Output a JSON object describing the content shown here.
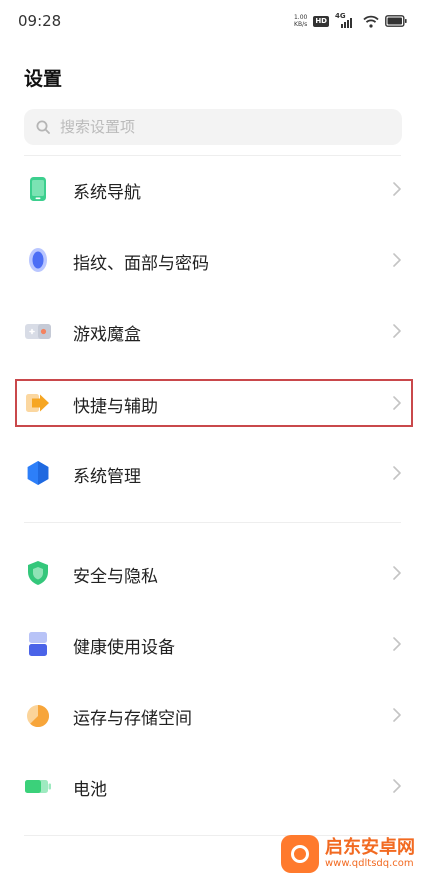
{
  "status_bar": {
    "time": "09:28",
    "net_speed_value": "1.00",
    "net_speed_unit": "KB/s",
    "hd_label": "HD",
    "network_label": "4G"
  },
  "page": {
    "title": "设置"
  },
  "search": {
    "placeholder": "搜索设置项"
  },
  "settings_items": [
    {
      "label": "系统导航",
      "icon": "phone-icon",
      "color": "#3ccf8e"
    },
    {
      "label": "指纹、面部与密码",
      "icon": "fingerprint-icon",
      "color": "#4c6ef5"
    },
    {
      "label": "游戏魔盒",
      "icon": "gamepad-icon",
      "color": "#f4825f"
    },
    {
      "label": "快捷与辅助",
      "icon": "shortcut-arrow-icon",
      "color": "#f6a623"
    },
    {
      "label": "系统管理",
      "icon": "hexagon-icon",
      "color": "#2d7ff9"
    },
    {
      "label": "安全与隐私",
      "icon": "shield-icon",
      "color": "#34c77b"
    },
    {
      "label": "健康使用设备",
      "icon": "hourglass-icon",
      "color": "#4a63e8"
    },
    {
      "label": "运存与存储空间",
      "icon": "pie-chart-icon",
      "color": "#f7a53a"
    },
    {
      "label": "电池",
      "icon": "battery-icon",
      "color": "#3bd17a"
    }
  ],
  "highlight": {
    "color": "#c9484b",
    "target": "快捷与辅助"
  },
  "watermark": {
    "title": "启东安卓网",
    "url": "www.qdltsdq.com"
  }
}
